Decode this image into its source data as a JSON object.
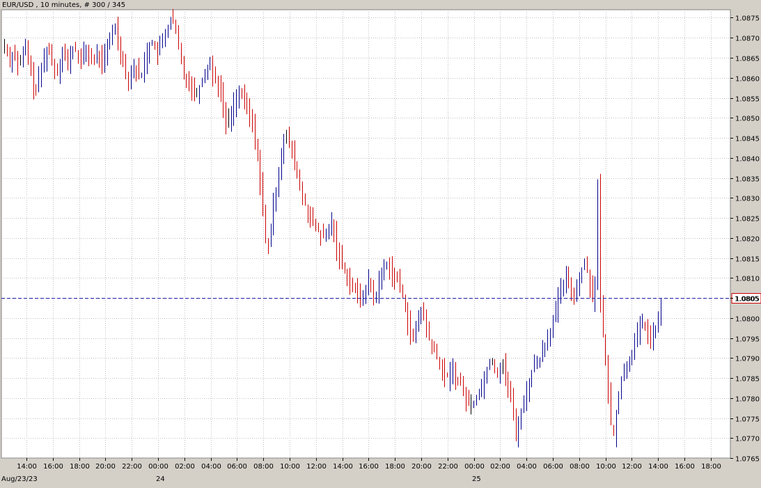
{
  "header": {
    "title": "EUR/USD , 10 minutes, # 300 / 345"
  },
  "colors": {
    "background": "#d4d0c8",
    "plot_background": "#ffffff",
    "grid": "#c0c0c0",
    "up_bar": "#00008b",
    "down_bar": "#cc0000",
    "neutral_bar": "#000000",
    "price_line": "#1a1aa8",
    "price_label_border": "#cc0000"
  },
  "chart_data": {
    "type": "ohlc",
    "symbol": "EUR/USD",
    "interval": "10 minutes",
    "bar_count_shown": "300 / 345",
    "ylim": [
      1.0765,
      1.0877
    ],
    "y_ticks": [
      "1.0765",
      "1.0770",
      "1.0775",
      "1.0780",
      "1.0785",
      "1.0790",
      "1.0795",
      "1.0800",
      "1.0805",
      "1.0810",
      "1.0815",
      "1.0820",
      "1.0825",
      "1.0830",
      "1.0835",
      "1.0840",
      "1.0845",
      "1.0850",
      "1.0855",
      "1.0860",
      "1.0865",
      "1.0870",
      "1.0875"
    ],
    "x_ticks": [
      "14:00",
      "16:00",
      "18:00",
      "20:00",
      "22:00",
      "00:00",
      "02:00",
      "04:00",
      "06:00",
      "08:00",
      "10:00",
      "12:00",
      "14:00",
      "16:00",
      "18:00",
      "20:00",
      "22:00",
      "00:00",
      "02:00",
      "04:00",
      "06:00",
      "08:00",
      "10:00",
      "12:00",
      "14:00",
      "16:00",
      "18:00"
    ],
    "date_labels": [
      {
        "label": "Aug/23/23",
        "at_tick": 0
      },
      {
        "label": "24",
        "at_tick": 5
      },
      {
        "label": "25",
        "at_tick": 17
      }
    ],
    "first_bar_time": "13:10",
    "grid": true,
    "last_price": 1.0805,
    "last_price_label": "1.0805",
    "path": [
      1.0868,
      1.0866,
      1.0864,
      1.0867,
      1.0865,
      1.0862,
      1.0865,
      1.0868,
      1.0866,
      1.0861,
      1.0858,
      1.0857,
      1.086,
      1.0863,
      1.0866,
      1.0868,
      1.0865,
      1.0863,
      1.0861,
      1.0864,
      1.0867,
      1.0865,
      1.0863,
      1.0866,
      1.0868,
      1.0866,
      1.0864,
      1.0865,
      1.0867,
      1.0866,
      1.0865,
      1.0864,
      1.0866,
      1.0865,
      1.0864,
      1.0866,
      1.0868,
      1.0871,
      1.0874,
      1.087,
      1.0867,
      1.0864,
      1.0861,
      1.086,
      1.0862,
      1.0863,
      1.0861,
      1.086,
      1.0863,
      1.0866,
      1.0868,
      1.0869,
      1.0867,
      1.0866,
      1.0868,
      1.087,
      1.0872,
      1.0874,
      1.0875,
      1.0872,
      1.0868,
      1.0864,
      1.0861,
      1.086,
      1.0859,
      1.0857,
      1.0856,
      1.0857,
      1.0859,
      1.0861,
      1.0863,
      1.0864,
      1.0861,
      1.086,
      1.0858,
      1.0855,
      1.0851,
      1.0848,
      1.085,
      1.0853,
      1.0855,
      1.0856,
      1.0855,
      1.0854,
      1.0852,
      1.085,
      1.0847,
      1.0843,
      1.0838,
      1.0829,
      1.082,
      1.0817,
      1.0822,
      1.0828,
      1.0833,
      1.0838,
      1.0843,
      1.0846,
      1.0844,
      1.0842,
      1.084,
      1.0836,
      1.0833,
      1.083,
      1.0828,
      1.0826,
      1.0824,
      1.0823,
      1.0822,
      1.0821,
      1.082,
      1.082,
      1.0822,
      1.0824,
      1.0821,
      1.0817,
      1.0815,
      1.0813,
      1.0811,
      1.081,
      1.0808,
      1.0807,
      1.0806,
      1.0805,
      1.0806,
      1.0808,
      1.0809,
      1.0807,
      1.0804,
      1.0808,
      1.081,
      1.0812,
      1.0814,
      1.0813,
      1.0811,
      1.081,
      1.0809,
      1.0807,
      1.0805,
      1.0801,
      1.0797,
      1.0793,
      1.0797,
      1.08,
      1.0802,
      1.08,
      1.0797,
      1.0794,
      1.0792,
      1.0791,
      1.0789,
      1.0787,
      1.0786,
      1.0785,
      1.0786,
      1.0787,
      1.0785,
      1.0784,
      1.0783,
      1.0781,
      1.0779,
      1.0778,
      1.0779,
      1.078,
      1.0782,
      1.0783,
      1.0785,
      1.0788,
      1.079,
      1.0789,
      1.0786,
      1.0787,
      1.0789,
      1.0786,
      1.0783,
      1.078,
      1.0775,
      1.077,
      1.0775,
      1.0778,
      1.078,
      1.0783,
      1.0786,
      1.0788,
      1.0789,
      1.079,
      1.0792,
      1.0794,
      1.0796,
      1.0798,
      1.08,
      1.0803,
      1.0806,
      1.0808,
      1.081,
      1.0809,
      1.0807,
      1.0806,
      1.0808,
      1.0811,
      1.0813,
      1.0814,
      1.081,
      1.0806,
      1.0802,
      1.0838,
      1.0803,
      1.0795,
      1.0787,
      1.078,
      1.077,
      1.0772,
      1.078,
      1.0784,
      1.0786,
      1.0788,
      1.079,
      1.0792,
      1.0794,
      1.0796,
      1.0798,
      1.0799,
      1.0797,
      1.0795,
      1.0795,
      1.0797,
      1.0799,
      1.0802
    ]
  }
}
